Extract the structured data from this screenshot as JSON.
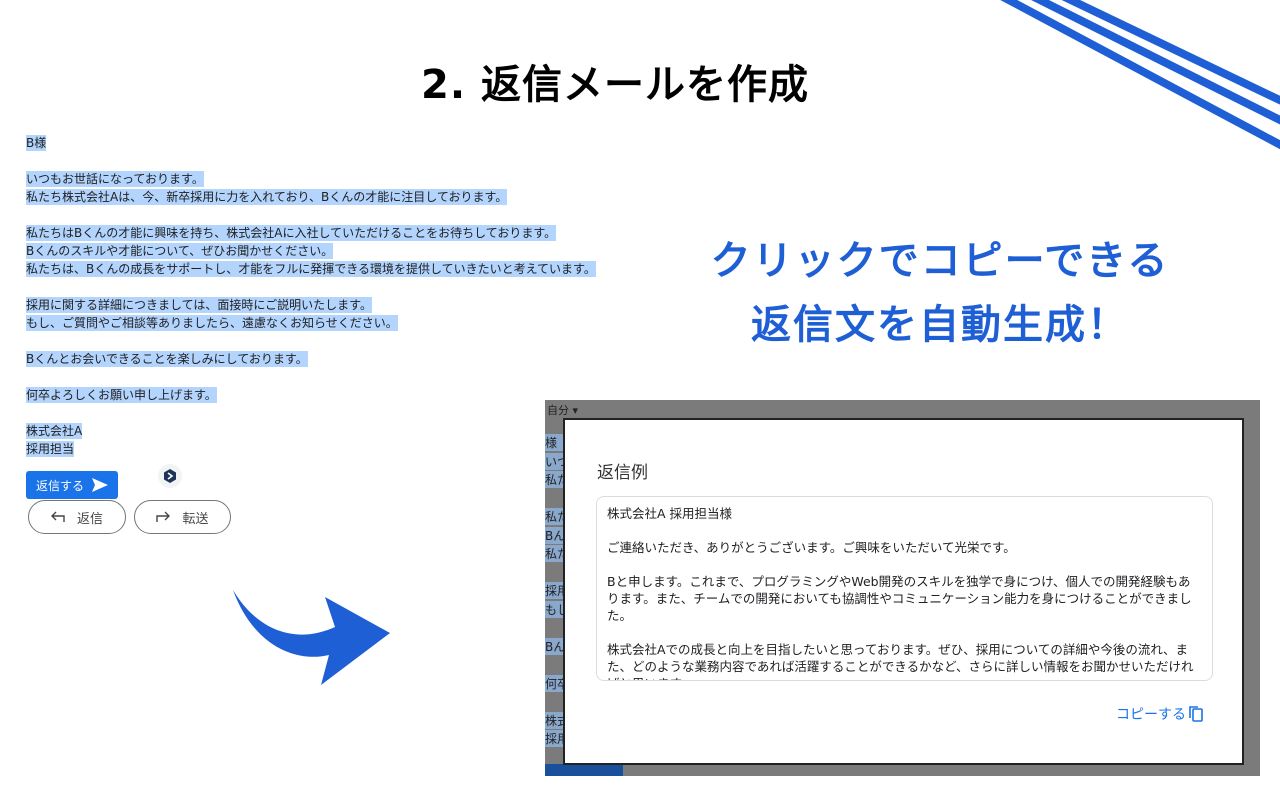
{
  "title": "2. 返信メールを作成",
  "email": {
    "lines": [
      "B様",
      "",
      "いつもお世話になっております。",
      "私たち株式会社Aは、今、新卒採用に力を入れており、Bくんの才能に注目しております。",
      "",
      "私たちはBくんの才能に興味を持ち、株式会社Aに入社していただけることをお待ちしております。",
      "Bくんのスキルや才能について、ぜひお聞かせください。",
      "私たちは、Bくんの成長をサポートし、才能をフルに発揮できる環境を提供していきたいと考えています。",
      "",
      "採用に関する詳細につきましては、面接時にご説明いたします。",
      "もし、ご質問やご相談等ありましたら、遠慮なくお知らせください。",
      "",
      "Bくんとお会いできることを楽しみにしております。",
      "",
      "何卒よろしくお願い申し上げます。",
      "",
      "株式会社A",
      "採用担当"
    ],
    "reply_button": "返信する",
    "reply_pill": "返信",
    "forward_pill": "転送"
  },
  "tagline": {
    "line1": "クリックでコピーできる",
    "line2": "返信文を自動生成！"
  },
  "screenshot": {
    "behind_label": "自分 ▾",
    "behind_fragments": [
      "様",
      "いつ",
      "私た",
      "",
      "私た",
      "Bん",
      "私た",
      "",
      "採用に",
      "もし、",
      "",
      "Bん",
      "",
      "何卒よ",
      "",
      "株式会",
      "採用担"
    ]
  },
  "modal": {
    "title": "返信例",
    "paragraphs": [
      "株式会社A 採用担当様",
      "ご連絡いただき、ありがとうございます。ご興味をいただいて光栄です。",
      "Bと申します。これまで、プログラミングやWeb開発のスキルを独学で身につけ、個人での開発経験もあります。また、チームでの開発においても協調性やコミュニケーション能力を身につけることができました。",
      "株式会社Aでの成長と向上を目指したいと思っております。ぜひ、採用についての詳細や今後の流れ、また、どのような業務内容であれば活躍することができるかなど、さらに詳しい情報をお聞かせいただければと思います。"
    ],
    "copy_label": "コピーする"
  },
  "colors": {
    "accent_blue": "#1f5fd6",
    "gmail_blue": "#1a73e8",
    "selection": "#b3d4fc"
  }
}
